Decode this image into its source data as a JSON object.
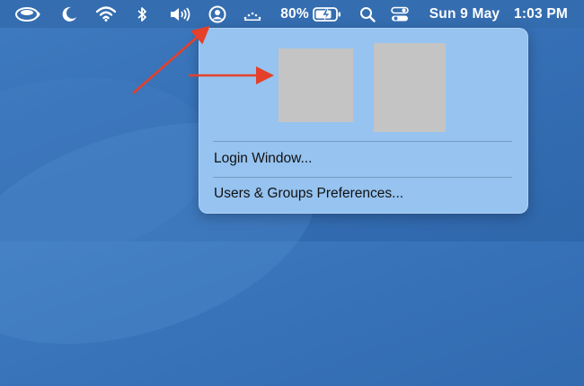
{
  "menubar": {
    "items": [
      "coffee-cup-icon",
      "moon-icon",
      "wifi-icon",
      "bluetooth-icon",
      "volume-icon",
      "user-account-icon",
      "brightness-icon",
      "battery-icon",
      "search-icon",
      "control-center-icon"
    ],
    "battery_percent": "80%",
    "date": "Sun 9 May",
    "time": "1:03 PM"
  },
  "user_menu": {
    "login_window_label": "Login Window...",
    "preferences_label": "Users & Groups Preferences..."
  },
  "colors": {
    "arrow": "#e5402a",
    "avatar_placeholder": "#c4c4c4",
    "menu_background": "#96c3f0"
  }
}
